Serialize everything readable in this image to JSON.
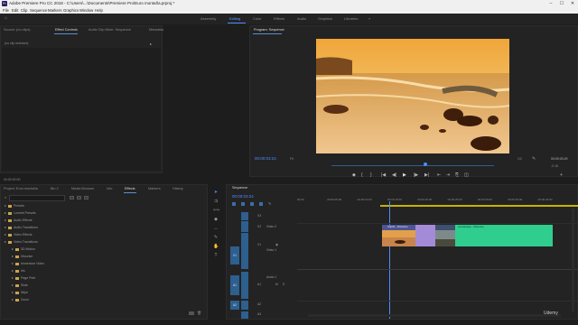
{
  "window": {
    "title": "Adobe Premiere Pro CC 2018 - C:\\Users\\...\\Documents\\Premiere Pro\\Euro montaña.prproj *"
  },
  "menu": [
    "File",
    "Edit",
    "Clip",
    "Sequence",
    "Markers",
    "Graphics",
    "Window",
    "Help"
  ],
  "workspaces": {
    "items": [
      "Assembly",
      "Editing",
      "Color",
      "Effects",
      "Audio",
      "Graphics",
      "Libraries"
    ],
    "active": "Editing",
    "more": "»"
  },
  "source_panel": {
    "tabs": [
      "Source: (no clips)",
      "Effect Controls",
      "Audio Clip Mixer: Sequence",
      "Metadata"
    ],
    "active_tab": "Effect Controls",
    "subheader": "(no clip selected)",
    "footer_tc": "00:00:00:00"
  },
  "program_panel": {
    "tab": "Program: Sequence",
    "timecode": "00:00:03:24",
    "fit": "Fit",
    "quality": "1/2",
    "duration": "00:00:03:29",
    "dim_right": "-0:16",
    "playhead_pct": 0.58,
    "transport": [
      "◆",
      "{",
      "}",
      "|◀",
      "◀|",
      "▶",
      "|▶",
      "▶|",
      "⇤",
      "⇥",
      "⎘",
      "◫",
      "+"
    ]
  },
  "project_panel": {
    "tabs": [
      "Project: Euro montaña",
      "Bin 2",
      "Media Browser",
      "Info",
      "Effects",
      "Markers",
      "History"
    ],
    "active_tab": "Effects",
    "search_placeholder": "",
    "tree": [
      {
        "label": "Presets",
        "type": "folder"
      },
      {
        "label": "Lumetri Presets",
        "type": "folder"
      },
      {
        "label": "Audio Effects",
        "type": "folder"
      },
      {
        "label": "Audio Transitions",
        "type": "folder"
      },
      {
        "label": "Video Effects",
        "type": "folder"
      },
      {
        "label": "Video Transitions",
        "type": "folder-open"
      },
      {
        "label": "3D Motion",
        "type": "child"
      },
      {
        "label": "Dissolve",
        "type": "child"
      },
      {
        "label": "Immersive Video",
        "type": "child"
      },
      {
        "label": "Iris",
        "type": "child"
      },
      {
        "label": "Page Peel",
        "type": "child"
      },
      {
        "label": "Slide",
        "type": "child"
      },
      {
        "label": "Wipe",
        "type": "child"
      },
      {
        "label": "Zoom",
        "type": "child"
      }
    ]
  },
  "timeline": {
    "tab": "Sequence",
    "timecode": "00:00:03:24",
    "ruler": [
      "00:00",
      "00:00:05:00",
      "00:00:10:00",
      "00:00:15:00",
      "00:00:20:00",
      "00:00:25:00",
      "00:00:30:00",
      "00:00:35:00",
      "00:00:40:00"
    ],
    "video_tracks": [
      "V3",
      "V2",
      "V1"
    ],
    "audio_tracks": [
      "A1",
      "A2",
      "A3"
    ],
    "source_patch": [
      "V1",
      "A1",
      "A2"
    ],
    "track_names": {
      "V2": "Video 2",
      "V1": "Video 1",
      "A1": "Audio 1"
    },
    "clips": {
      "clip1": "Clip01 - Dissolve",
      "clip2": "Landscape - Dissolve"
    },
    "playhead_pct": 0.34
  },
  "status": {
    "watermark": "Udemy"
  },
  "colors": {
    "accent": "#4d8fff",
    "clip_video": "#5a5f9a",
    "transition": "#a48bd8",
    "clip_green": "#2fce8e"
  }
}
